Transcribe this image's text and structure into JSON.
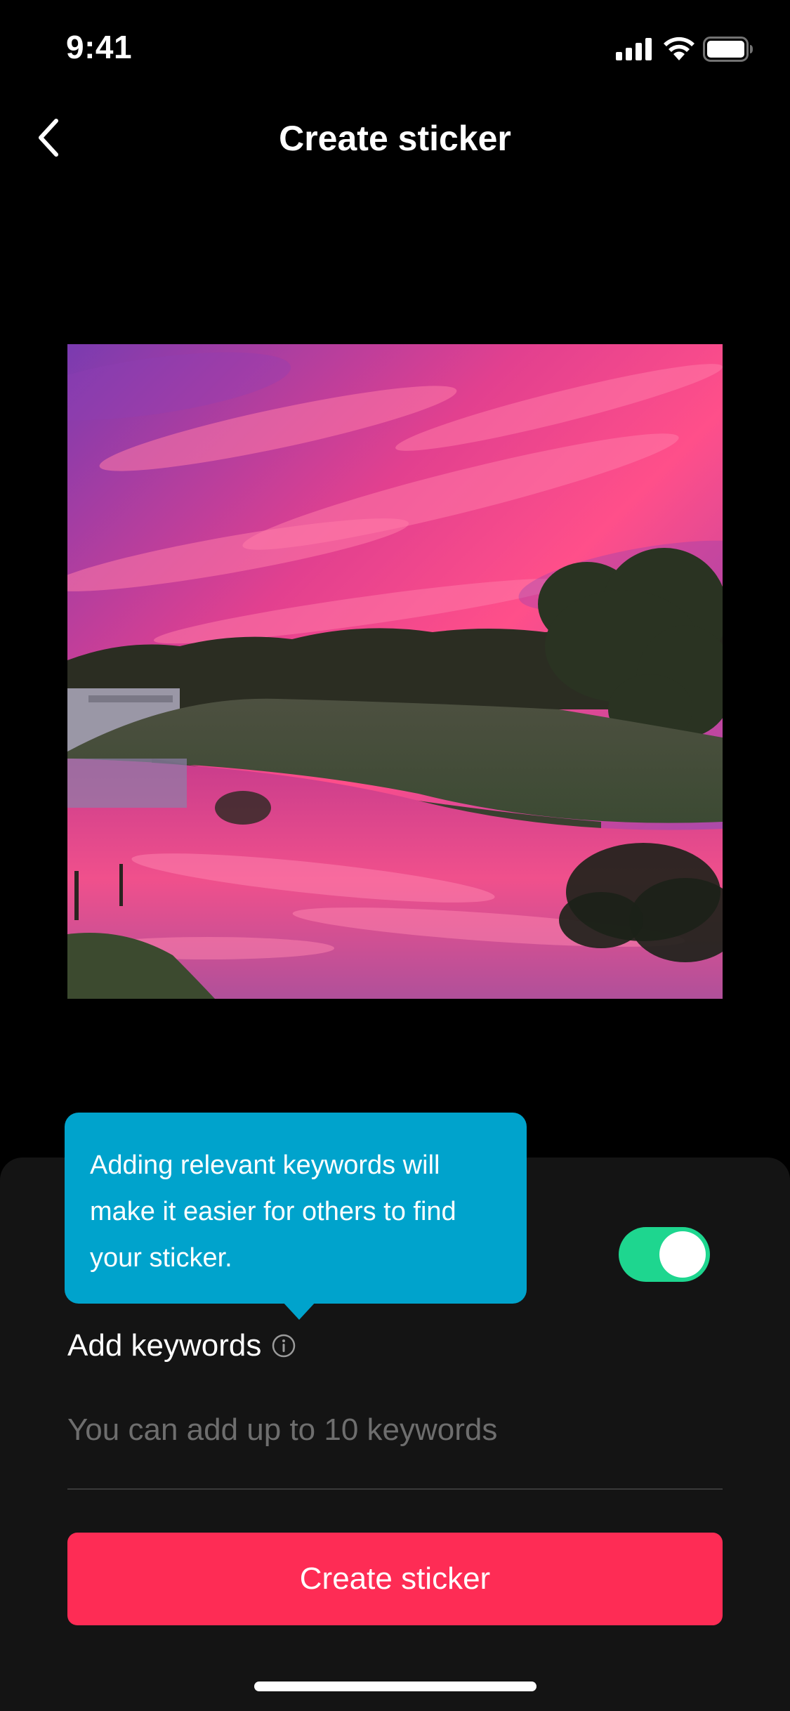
{
  "status_bar": {
    "time": "9:41",
    "icons": [
      "cellular-signal-icon",
      "wifi-icon",
      "battery-icon"
    ]
  },
  "nav": {
    "back_icon": "chevron-left-icon",
    "title": "Create sticker"
  },
  "sticker": {
    "image_description": "sunset-landscape-photo"
  },
  "settings": {
    "toggle_on": true
  },
  "tooltip": {
    "text": "Adding relevant keywords will make it easier for others to find your sticker."
  },
  "keywords": {
    "label": "Add keywords",
    "info_icon": "info-icon",
    "placeholder": "You can add up to 10 keywords",
    "value": ""
  },
  "actions": {
    "create_label": "Create sticker"
  },
  "colors": {
    "background": "#000000",
    "sheet": "#141414",
    "accent": "#fe2c55",
    "toggle_on": "#1ed68f",
    "tooltip": "#00a3cc"
  }
}
